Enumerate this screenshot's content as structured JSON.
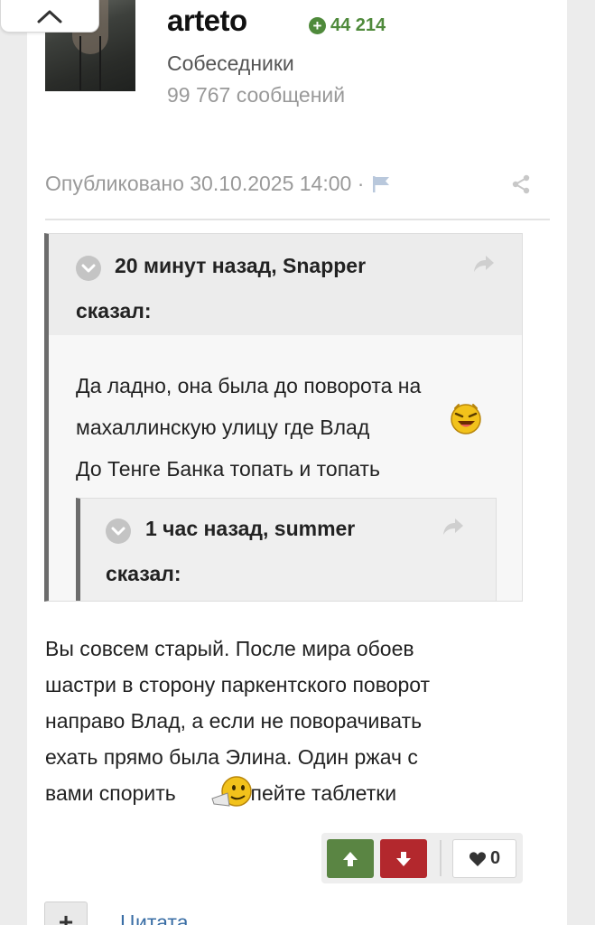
{
  "author": {
    "username": "arteto",
    "reputation": "44 214",
    "group": "Собеседники",
    "post_count": "99 767 сообщений"
  },
  "post": {
    "published": "Опубликовано 30.10.2025 14:00 ·",
    "quote_outer": {
      "cite_line1": "20 минут назад, Snapper",
      "cite_line2": "сказал:",
      "lines": [
        "Да ладно, она была до поворота на",
        "махаллинскую улицу где Влад",
        "До Тенге Банка топать и топать"
      ],
      "quote_inner": {
        "cite_line1": "1 час назад, summer",
        "cite_line2": "сказал:"
      }
    },
    "body_lines": [
      "Вы совсем старый. После мира обоев",
      "шастри в сторону паркентского поворот",
      "направо Влад, а если не поворачивать",
      "ехать прямо была Элина. Один ржач с",
      "вами спорить"
    ],
    "body_tail": "пейте таблетки",
    "likes": "0"
  },
  "actions": {
    "plus_label": "+",
    "quote_label": "Цитата"
  },
  "colors": {
    "reputation": "#4f8a3b",
    "vote_up": "#5a8543",
    "vote_down": "#b3282d",
    "link": "#3a6ea5"
  },
  "icons": {
    "collapse": "chevron-up-icon",
    "flag": "flag-icon",
    "share": "share-icon",
    "quote_toggle": "chevron-down-circle-icon",
    "reply": "reply-arrow-icon",
    "upvote": "arrow-up-icon",
    "downvote": "arrow-down-icon",
    "like": "heart-icon"
  }
}
